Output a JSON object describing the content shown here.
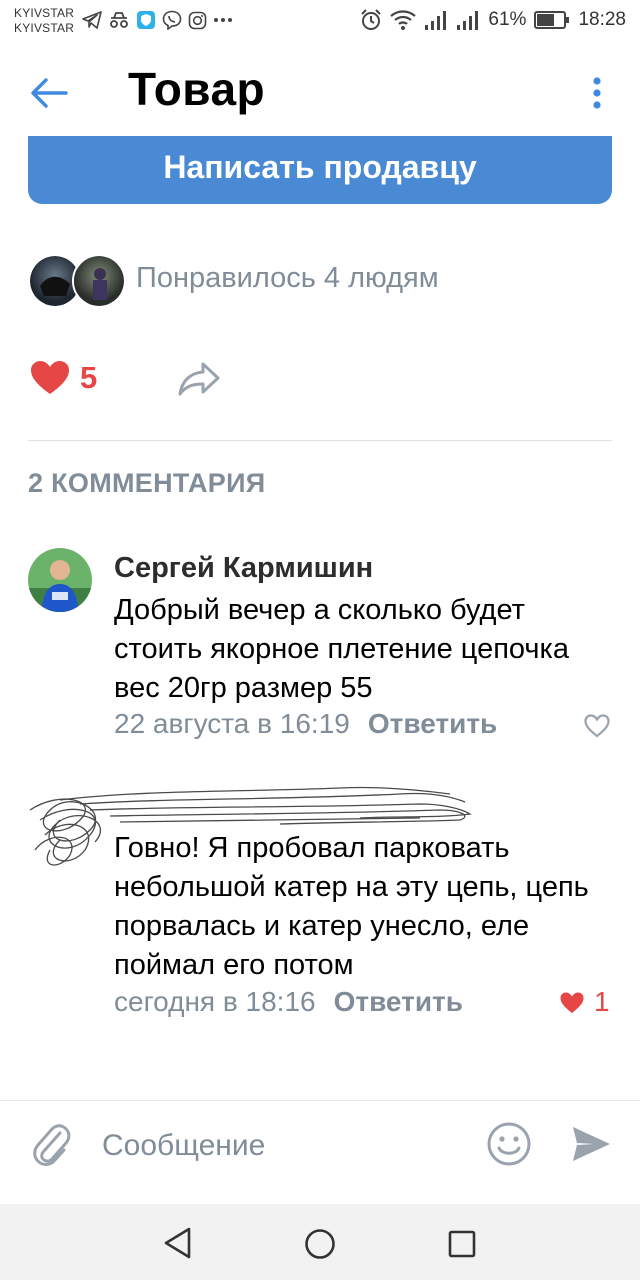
{
  "status": {
    "carrier1": "KYIVSTAR",
    "carrier2": "KYIVSTAR",
    "battery": "61%",
    "time": "18:28",
    "icons": [
      "telegram-icon",
      "incognito-icon",
      "shield-icon",
      "viber-icon",
      "instagram-icon",
      "more-icon",
      "alarm-icon",
      "wifi-icon",
      "signal-icon",
      "battery-icon"
    ]
  },
  "header": {
    "title": "Товар",
    "back_icon": "arrow-left-icon",
    "menu_icon": "kebab-menu-icon"
  },
  "product": {
    "write_seller_label": "Написать продавцу",
    "liked_text": "Понравилось 4 людям",
    "like_count": "5",
    "accent": "#4a89d4",
    "like_color": "#e64646"
  },
  "comments": {
    "header": "2 КОММЕНТАРИЯ",
    "items": [
      {
        "author": "Сергей Кармишин",
        "text": "Добрый вечер а сколько будет стоить якорное плетение цепочка вес 20гр размер 55",
        "time": "22 августа в 16:19",
        "reply_label": "Ответить",
        "likes": ""
      },
      {
        "author": "",
        "text": "Говно! Я пробовал парковать небольшой катер на эту цепь, цепь порвалась и катер унесло, еле поймал его потом",
        "time": "сегодня в 18:16",
        "reply_label": "Ответить",
        "likes": "1"
      }
    ]
  },
  "composer": {
    "placeholder": "Сообщение"
  }
}
